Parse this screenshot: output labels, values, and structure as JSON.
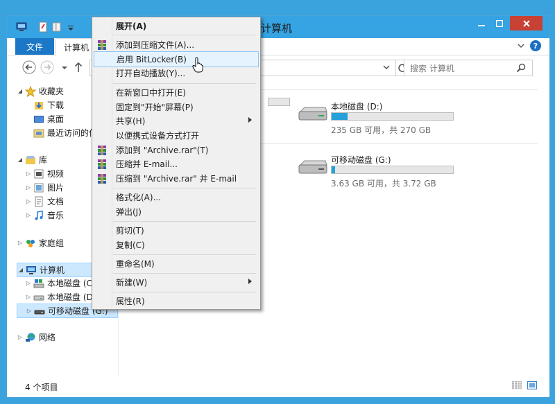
{
  "window": {
    "title": "计算机"
  },
  "ribbon": {
    "tabs": [
      {
        "label": "文件"
      },
      {
        "label": "计算机"
      }
    ]
  },
  "search": {
    "placeholder": "搜索 计算机"
  },
  "nav": {
    "favorites": "收藏夹",
    "downloads": "下载",
    "desktop": "桌面",
    "recent": "最近访问的位置",
    "libraries": "库",
    "videos": "视频",
    "pictures": "图片",
    "documents": "文档",
    "music": "音乐",
    "homegroup": "家庭组",
    "computer": "计算机",
    "local_c": "本地磁盘 (C:)",
    "local_d": "本地磁盘 (D:)",
    "removable_g": "可移动磁盘 (G:)",
    "network": "网络"
  },
  "drives": [
    {
      "name": "本地磁盘 (D:)",
      "free_text": "235 GB 可用，共 270 GB",
      "used_fraction": 0.13
    },
    {
      "name": "可移动磁盘 (G:)",
      "free_text": "3.63 GB 可用，共 3.72 GB",
      "used_fraction": 0.03
    }
  ],
  "status": {
    "item_count": "4 个项目"
  },
  "menu": {
    "items": [
      {
        "label": "展开(A)",
        "bold": true
      },
      {
        "label": "添加到压缩文件(A)...",
        "icon": "winrar-icon"
      },
      {
        "label": "启用 BitLocker(B)",
        "highlighted": true
      },
      {
        "label": "打开自动播放(Y)..."
      },
      {
        "label": "在新窗口中打开(E)"
      },
      {
        "label": "固定到\"开始\"屏幕(P)"
      },
      {
        "label": "共享(H)",
        "submenu": true
      },
      {
        "label": "以便携式设备方式打开"
      },
      {
        "label": "添加到 \"Archive.rar\"(T)",
        "icon": "winrar-icon"
      },
      {
        "label": "压缩并 E-mail...",
        "icon": "winrar-icon"
      },
      {
        "label": "压缩到 \"Archive.rar\" 并 E-mail",
        "icon": "winrar-icon"
      },
      {
        "label": "格式化(A)..."
      },
      {
        "label": "弹出(J)"
      },
      {
        "label": "剪切(T)"
      },
      {
        "label": "复制(C)"
      },
      {
        "label": "重命名(M)"
      },
      {
        "label": "新建(W)",
        "submenu": true
      },
      {
        "label": "属性(R)"
      }
    ]
  },
  "colors": {
    "titlebar": "#36a3e3",
    "accent": "#1c77c7",
    "close": "#c74234",
    "selection": "#cce8ff",
    "drive_bar": "#26a0da"
  }
}
